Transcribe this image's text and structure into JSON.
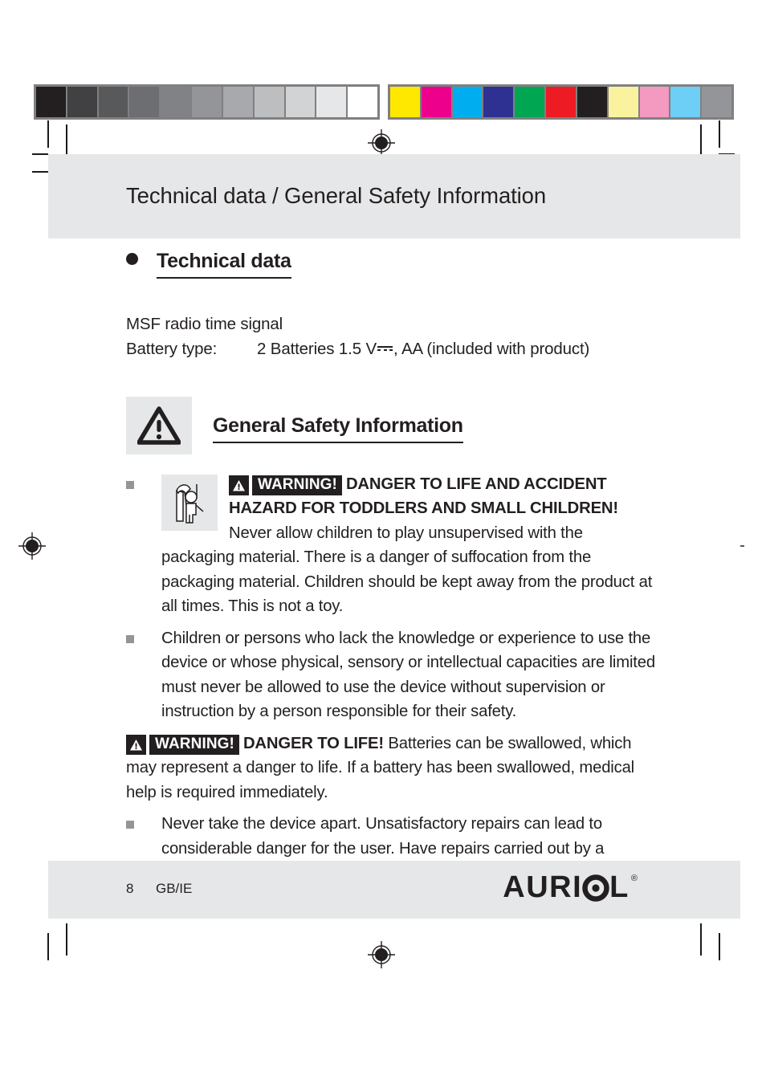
{
  "print_marks": {
    "grayscale_patches": [
      "#231f20",
      "#414042",
      "#58595b",
      "#6d6e71",
      "#808285",
      "#939598",
      "#a7a9ac",
      "#bcbec0",
      "#d1d3d4",
      "#e6e7e8",
      "#ffffff"
    ],
    "color_patches": [
      "#ffe800",
      "#ec008c",
      "#00aeef",
      "#2e3192",
      "#00a651",
      "#ed1c24",
      "#231f20",
      "#fbf2a0",
      "#f49ac1",
      "#6dcff6",
      "#939598"
    ],
    "strip_background": "#808080"
  },
  "header": {
    "title": "Technical data / General Safety Information",
    "band_color": "#e6e7e8"
  },
  "technical_data": {
    "heading": "Technical data",
    "bullet_icon": "filled-circle-icon",
    "lines": [
      {
        "label": "MSF radio time signal",
        "value": ""
      }
    ],
    "battery_label": "Battery type:",
    "battery_value_before": "2 Batteries 1.5 V",
    "battery_symbol": "dc-voltage-icon",
    "battery_value_after": ", AA (included with product)"
  },
  "safety": {
    "heading": "General Safety Information",
    "triangle_icon": "warning-triangle-icon",
    "items": [
      {
        "id": "toddlers-warning",
        "bullet": "square-bullet-icon",
        "icon": "child-packaging-hazard-icon",
        "warning_label": "WARNING!",
        "warning_icon": "warning-triangle-icon",
        "bold_text": "DANGER TO LIFE AND ACCIDENT HAZARD FOR TODDLERS AND SMALL CHILDREN!",
        "body_text": " Never allow children to play unsupervised with the packaging material. There is a danger of suffocation from the packaging material. Children should be kept away from the product at all times. This is not a toy."
      },
      {
        "id": "supervision-requirement",
        "bullet": "square-bullet-icon",
        "body_text": "Children or persons who lack the knowledge or experience to use the device or whose physical, sensory or intellectual capacities are limited must never be allowed to use the device without supervision or instruction by a person responsible for their safety."
      },
      {
        "id": "battery-swallow-warning",
        "warning_label": "WARNING!",
        "warning_icon": "warning-triangle-icon",
        "bold_text": "DANGER TO LIFE!",
        "body_text": " Batteries can be swallowed, which may represent a danger to life. If a battery has been swallowed, medical help is required immediately."
      },
      {
        "id": "no-disassembly",
        "bullet": "square-bullet-icon",
        "body_text": "Never take the device apart. Unsatisfactory repairs can lead to considerable danger for the user. Have repairs carried out by a suitably qualified or experienced specialist."
      }
    ]
  },
  "footer": {
    "page_number": "8",
    "locale": "GB/IE",
    "brand": "AURIOL",
    "trademark": "®",
    "band_color": "#e6e7e8"
  }
}
